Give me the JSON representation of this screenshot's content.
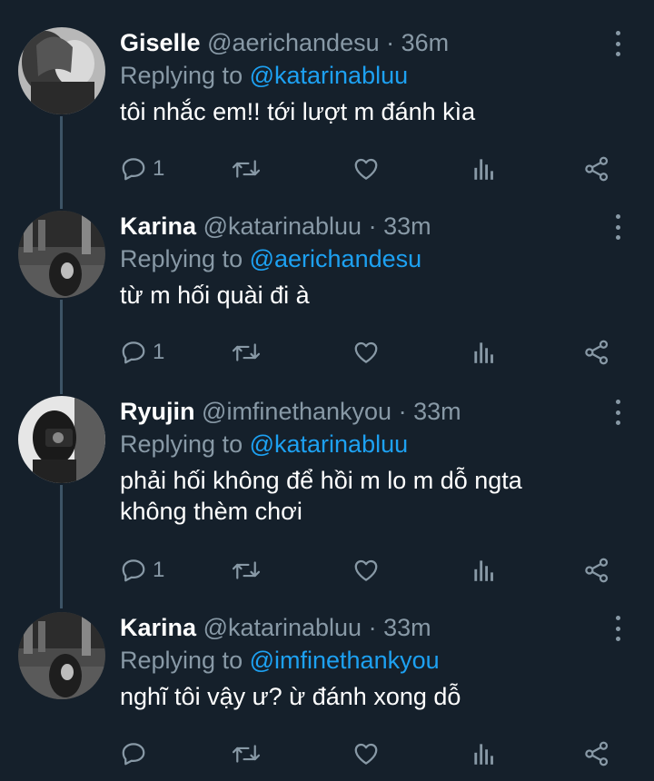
{
  "tweets": [
    {
      "name": "Giselle",
      "handle": "@aerichandesu",
      "time": "36m",
      "replying_prefix": "Replying to",
      "replying_to": "@katarinabluu",
      "text": "tôi nhắc em!! tới lượt m đánh kìa",
      "reply_count": "1"
    },
    {
      "name": "Karina",
      "handle": "@katarinabluu",
      "time": "33m",
      "replying_prefix": "Replying to",
      "replying_to": "@aerichandesu",
      "text": "từ m hối quài đi à",
      "reply_count": "1"
    },
    {
      "name": "Ryujin",
      "handle": "@imfinethankyou",
      "time": "33m",
      "replying_prefix": "Replying to",
      "replying_to": "@katarinabluu",
      "text": "phải hối không để hồi m lo m dỗ ngta không thèm chơi",
      "reply_count": "1"
    },
    {
      "name": "Karina",
      "handle": "@katarinabluu",
      "time": "33m",
      "replying_prefix": "Replying to",
      "replying_to": "@imfinethankyou",
      "text": "nghĩ tôi vậy ư? ừ đánh xong dỗ",
      "reply_count": ""
    }
  ],
  "icons": {
    "reply": "reply-icon",
    "retweet": "retweet-icon",
    "like": "heart-icon",
    "analytics": "analytics-icon",
    "share": "share-icon",
    "more": "more-vertical-icon"
  },
  "colors": {
    "background": "#15202b",
    "secondary_text": "#8899a6",
    "accent": "#1da1f2",
    "thread_line": "#3d5466"
  }
}
